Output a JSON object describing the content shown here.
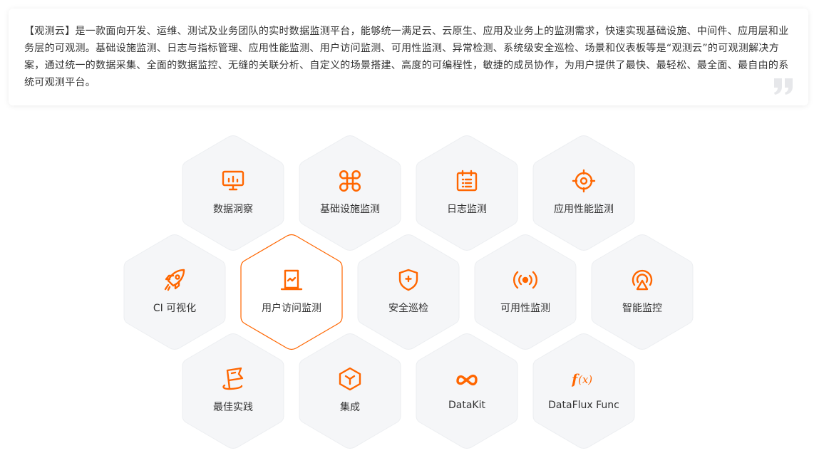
{
  "intro": {
    "text": "【观测云】是一款面向开发、运维、测试及业务团队的实时数据监测平台，能够统一满足云、云原生、应用及业务上的监测需求，快速实现基础设施、中间件、应用层和业务层的可观测。基础设施监测、日志与指标管理、应用性能监测、用户访问监测、可用性监测、异常检测、系统级安全巡检、场景和仪表板等是“观测云”的可观测解决方案，通过统一的数据采集、全面的数据监控、无缝的关联分析、自定义的场景搭建、高度的可编程性，敏捷的成员协作，为用户提供了最快、最轻松、最全面、最自由的系统可观测平台。"
  },
  "colors": {
    "accent": "#ff6600",
    "hex_fill": "#f5f6f8",
    "hex_stroke": "#eceef1",
    "text": "#333333"
  },
  "hexes": [
    {
      "label": "数据洞察",
      "icon": "monitor-chart-icon",
      "active": false
    },
    {
      "label": "基础设施监测",
      "icon": "command-icon",
      "active": false
    },
    {
      "label": "日志监测",
      "icon": "calendar-list-icon",
      "active": false
    },
    {
      "label": "应用性能监测",
      "icon": "crosshair-icon",
      "active": false
    },
    {
      "label": "CI 可视化",
      "icon": "rocket-icon",
      "active": false
    },
    {
      "label": "用户访问监测",
      "icon": "document-pulse-icon",
      "active": true
    },
    {
      "label": "安全巡检",
      "icon": "shield-plus-icon",
      "active": false
    },
    {
      "label": "可用性监测",
      "icon": "broadcast-icon",
      "active": false
    },
    {
      "label": "智能监控",
      "icon": "radar-icon",
      "active": false
    },
    {
      "label": "最佳实践",
      "icon": "flag-icon",
      "active": false
    },
    {
      "label": "集成",
      "icon": "cube-icon",
      "active": false
    },
    {
      "label": "DataKit",
      "icon": "datakit-logo-icon",
      "active": false
    },
    {
      "label": "DataFlux Func",
      "icon": "function-icon",
      "active": false
    }
  ]
}
